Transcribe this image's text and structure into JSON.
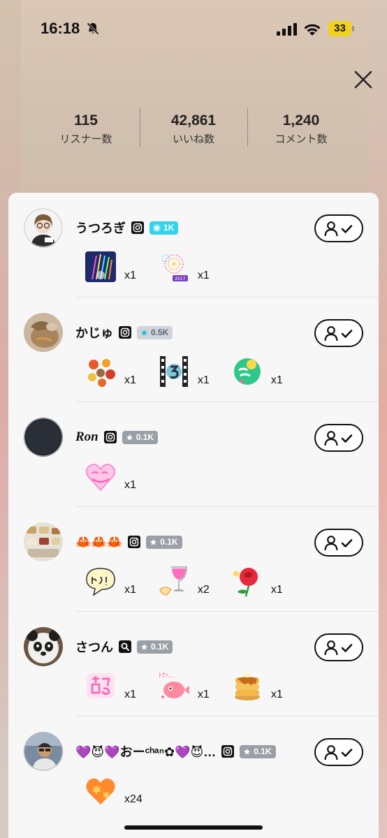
{
  "status": {
    "time": "16:18",
    "battery": "33"
  },
  "stats": [
    {
      "value": "115",
      "label": "リスナー数"
    },
    {
      "value": "42,861",
      "label": "いいね数"
    },
    {
      "value": "1,240",
      "label": "コメント数"
    }
  ],
  "listeners": [
    {
      "name": "うつろぎ",
      "badge": "1K",
      "badge_style": "cyan",
      "gifts": [
        {
          "icon": "fireworks-sparkle",
          "count": "x1"
        },
        {
          "icon": "fireworks-2017",
          "count": "x1"
        }
      ]
    },
    {
      "name": "かじゅ",
      "badge": "0.5K",
      "badge_style": "light",
      "gifts": [
        {
          "icon": "autumn-leaves",
          "count": "x1"
        },
        {
          "icon": "film-countdown-3",
          "count": "x1"
        },
        {
          "icon": "yoshiyoshi-ball",
          "count": "x1"
        }
      ]
    },
    {
      "name": "Ron",
      "badge": "0.1K",
      "badge_style": "grey",
      "gifts": [
        {
          "icon": "moemoe-kyun-heart",
          "count": "x1"
        }
      ]
    },
    {
      "name": "🦀🦀🦀",
      "badge": "0.1K",
      "badge_style": "grey",
      "gifts": [
        {
          "icon": "haai-speech-bubble",
          "count": "x1"
        },
        {
          "icon": "pink-drink-glass",
          "count": "x2"
        },
        {
          "icon": "red-rose",
          "count": "x1"
        }
      ]
    },
    {
      "name": "さつん",
      "badge": "0.1K",
      "badge_style": "grey",
      "gifts": [
        {
          "icon": "moe-text",
          "count": "x1"
        },
        {
          "icon": "tokun-heart-fish",
          "count": "x1"
        },
        {
          "icon": "pancakes",
          "count": "x1"
        }
      ]
    },
    {
      "name": "💜😈💜おーᶜʰᵃⁿ✿💜😈…",
      "badge": "0.1K",
      "badge_style": "grey",
      "gifts": [
        {
          "icon": "maple-heart",
          "count": "x24"
        }
      ]
    }
  ]
}
